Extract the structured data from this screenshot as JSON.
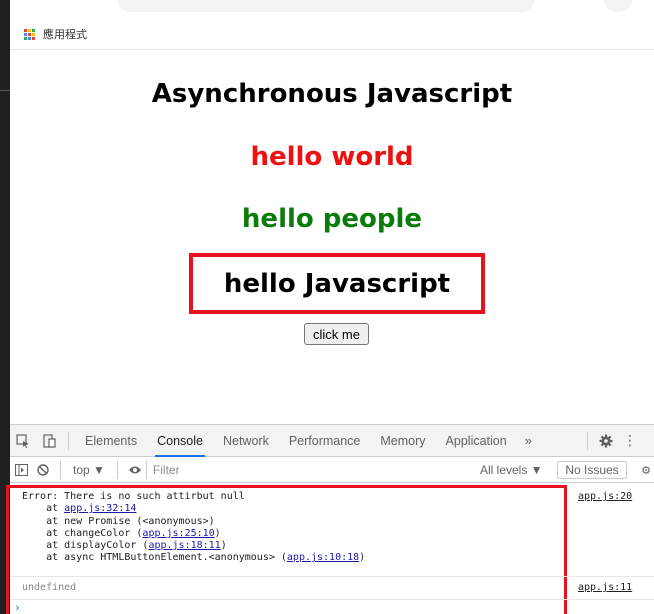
{
  "bookmarks": {
    "apps_label": "應用程式",
    "apps_colors": [
      "#ea4335",
      "#fbbc04",
      "#34a853",
      "#4285f4",
      "#ea4335",
      "#fbbc04",
      "#34a853",
      "#4285f4",
      "#ea4335"
    ]
  },
  "page": {
    "title": "Asynchronous Javascript",
    "line1": {
      "text": "hello world",
      "color": "#ef1010"
    },
    "line2": {
      "text": "hello people",
      "color": "#0a7c0a"
    },
    "boxed_text": "hello Javascript",
    "button_label": "click me"
  },
  "devtools": {
    "tabs": [
      "Elements",
      "Console",
      "Network",
      "Performance",
      "Memory",
      "Application"
    ],
    "active_tab": "Console",
    "more_label": "»",
    "context": "top ▼",
    "filter_placeholder": "Filter",
    "levels": "All levels ▼",
    "issues": "No Issues",
    "console": {
      "error": {
        "line0": "Error: There is no such attirbut null",
        "frames": [
          {
            "prefix": "    at ",
            "fn": "",
            "link": "app.js:32:14",
            "suffix": ""
          },
          {
            "prefix": "    at new Promise (<anonymous>)",
            "fn": "",
            "link": "",
            "suffix": ""
          },
          {
            "prefix": "    at changeColor (",
            "fn": "",
            "link": "app.js:25:10",
            "suffix": ")"
          },
          {
            "prefix": "    at displayColor (",
            "fn": "",
            "link": "app.js:18:11",
            "suffix": ")"
          },
          {
            "prefix": "    at async HTMLButtonElement.<anonymous> (",
            "fn": "",
            "link": "app.js:10:18",
            "suffix": ")"
          }
        ],
        "source": "app.js:20"
      },
      "result": {
        "text": "undefined",
        "source": "app.js:11"
      },
      "prompt": "›"
    }
  }
}
